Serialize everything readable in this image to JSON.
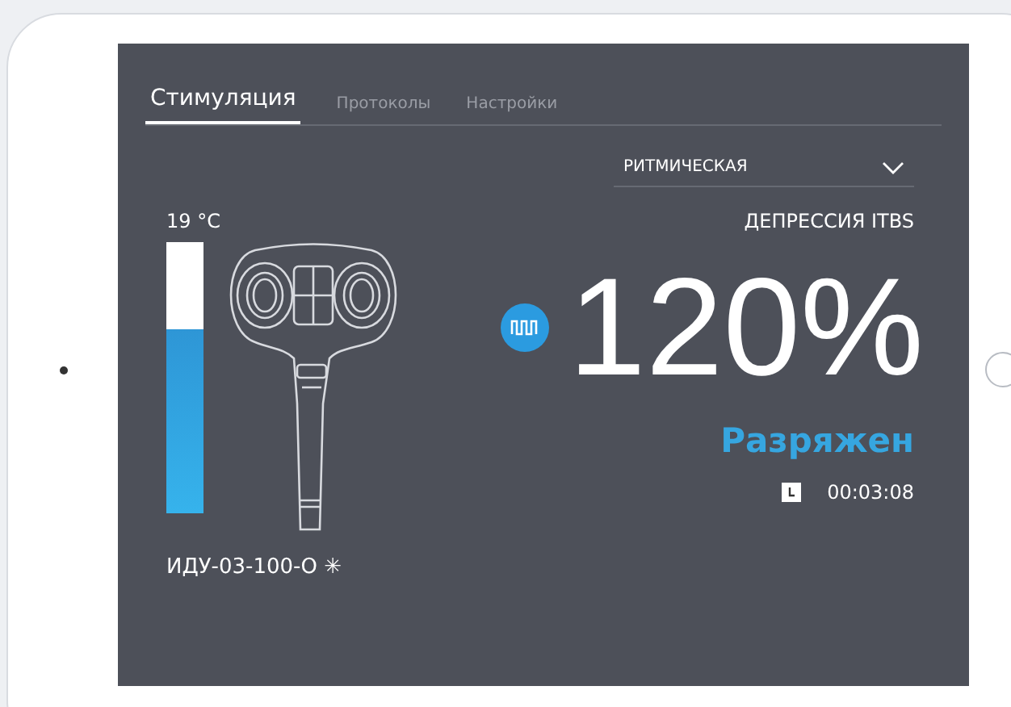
{
  "tabs": [
    {
      "label": "Стимуляция",
      "selected": true
    },
    {
      "label": "Протоколы",
      "selected": false
    },
    {
      "label": "Настройки",
      "selected": false
    }
  ],
  "mode_dropdown": {
    "value": "РИТМИЧЕСКАЯ"
  },
  "protocol": "ДЕПРЕССИЯ ITBS",
  "temperature": {
    "reading": "19 °C",
    "level": 0.68
  },
  "device_model": "ИДУ-03-100-О ✳",
  "intensity": "120%",
  "status": "Разряжен",
  "timer": "00:03:08"
}
